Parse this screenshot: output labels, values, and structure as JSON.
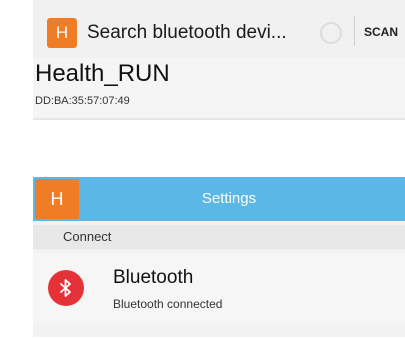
{
  "scan_screen": {
    "title": "Search bluetooth devi...",
    "scan_button": "SCAN",
    "app_icon_letter": "H",
    "device": {
      "name": "Health_RUN",
      "mac": "DD:BA:35:57:07:49"
    }
  },
  "settings_screen": {
    "title": "Settings",
    "app_icon_letter": "H",
    "section": "Connect",
    "bluetooth": {
      "label": "Bluetooth",
      "status": "Bluetooth connected",
      "icon": "bluetooth-icon"
    }
  },
  "colors": {
    "accent_orange": "#f07d26",
    "header_blue": "#5ab7e6",
    "bt_red": "#e53238"
  }
}
